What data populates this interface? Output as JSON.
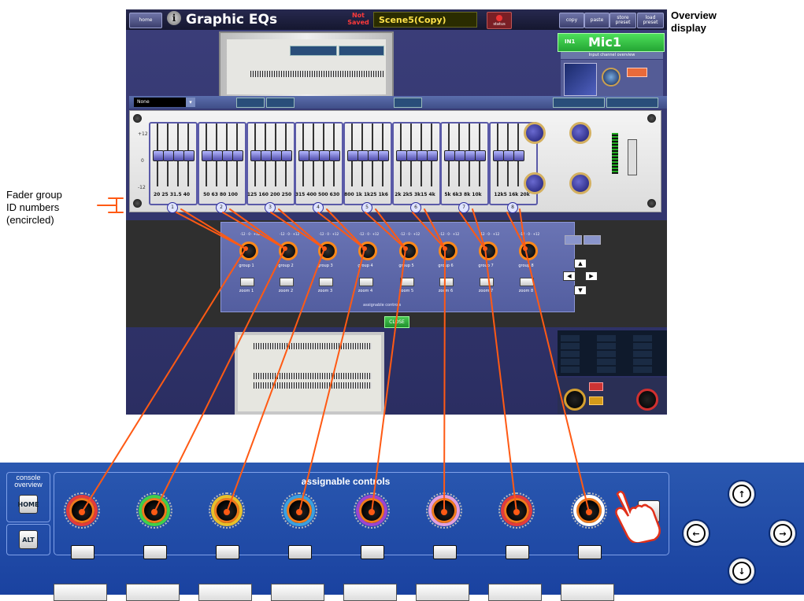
{
  "app": {
    "home_label": "home",
    "title": "Graphic EQs",
    "not_saved": "Not Saved",
    "scene_name": "Scene5(Copy)",
    "status_label": "status",
    "toolbar_buttons": [
      "copy",
      "paste",
      "store preset",
      "load preset"
    ],
    "channel_number": "IN1",
    "channel_name": "Mic1",
    "input_channel_overview": "Input channel overview",
    "preset_value": "None",
    "eq_group_ids": [
      "1",
      "2",
      "3",
      "4",
      "5",
      "6",
      "7",
      "8"
    ],
    "eq_frequencies": [
      "20",
      "25",
      "31.5",
      "40",
      "50",
      "63",
      "80",
      "100",
      "125",
      "160",
      "200",
      "250",
      "315",
      "400",
      "500",
      "630",
      "800",
      "1k",
      "1k25",
      "1k6",
      "2k",
      "2k5",
      "3k15",
      "4k",
      "5k",
      "6k3",
      "8k",
      "10k",
      "12k5",
      "16k",
      "20k"
    ],
    "db_scale": [
      "+12",
      "0",
      "-12"
    ],
    "assign_groups": [
      "group 1",
      "group 2",
      "group 3",
      "group 4",
      "group 5",
      "group 6",
      "group 7",
      "group 8"
    ],
    "assign_zooms": [
      "zoom 1",
      "zoom 2",
      "zoom 3",
      "zoom 4",
      "zoom 5",
      "zoom 6",
      "zoom 7",
      "zoom 8"
    ],
    "assignable_caption": "assignable controls",
    "close_label": "CLOSE"
  },
  "callouts": {
    "overview_display": [
      "Overview",
      "display"
    ],
    "fader_group": [
      "Fader group",
      "ID numbers",
      "(encircled)"
    ]
  },
  "console": {
    "overview_label": [
      "console",
      "overview"
    ],
    "home_button": "HOME",
    "alt_button": "ALT",
    "assignable_label": "assignable controls",
    "knob_ring_colors": [
      "#e23b3b",
      "#3fcf4a",
      "#e8c02a",
      "#3aa0e0",
      "#9b45d0",
      "#e0a0e0",
      "#e23b3b",
      "#ffffff"
    ]
  },
  "colors": {
    "accent_orange": "#ff5a14",
    "console_blue": "#1f4ba8",
    "app_bg": "#33366e"
  },
  "icons": [
    "info-icon",
    "hand-pointer-icon",
    "arrow-up-icon",
    "arrow-down-icon",
    "arrow-left-icon",
    "arrow-right-icon"
  ]
}
